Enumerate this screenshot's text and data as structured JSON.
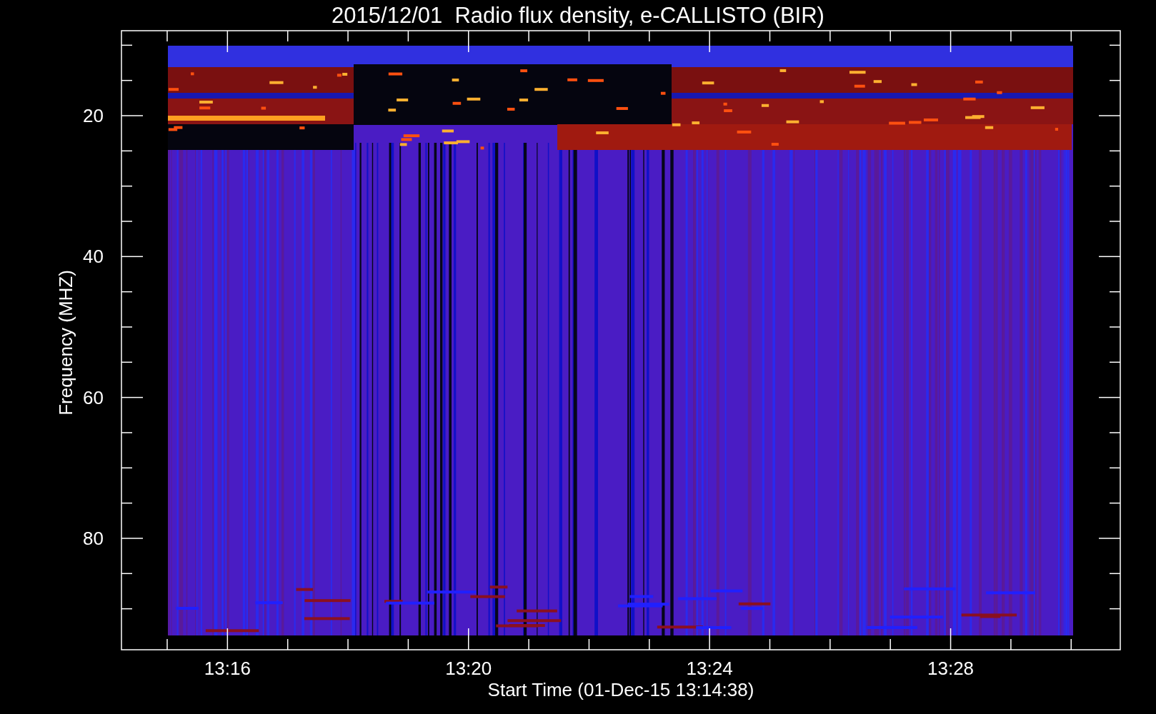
{
  "title": "2015/12/01  Radio flux density, e-CALLISTO (BIR)",
  "y_axis": {
    "label": "Frequency (MHZ)",
    "ticks": [
      "20",
      "40",
      "60",
      "80"
    ]
  },
  "x_axis": {
    "label": "Start Time (01-Dec-15 13:14:38)",
    "ticks": [
      "13:16",
      "13:20",
      "13:24",
      "13:28"
    ]
  }
}
